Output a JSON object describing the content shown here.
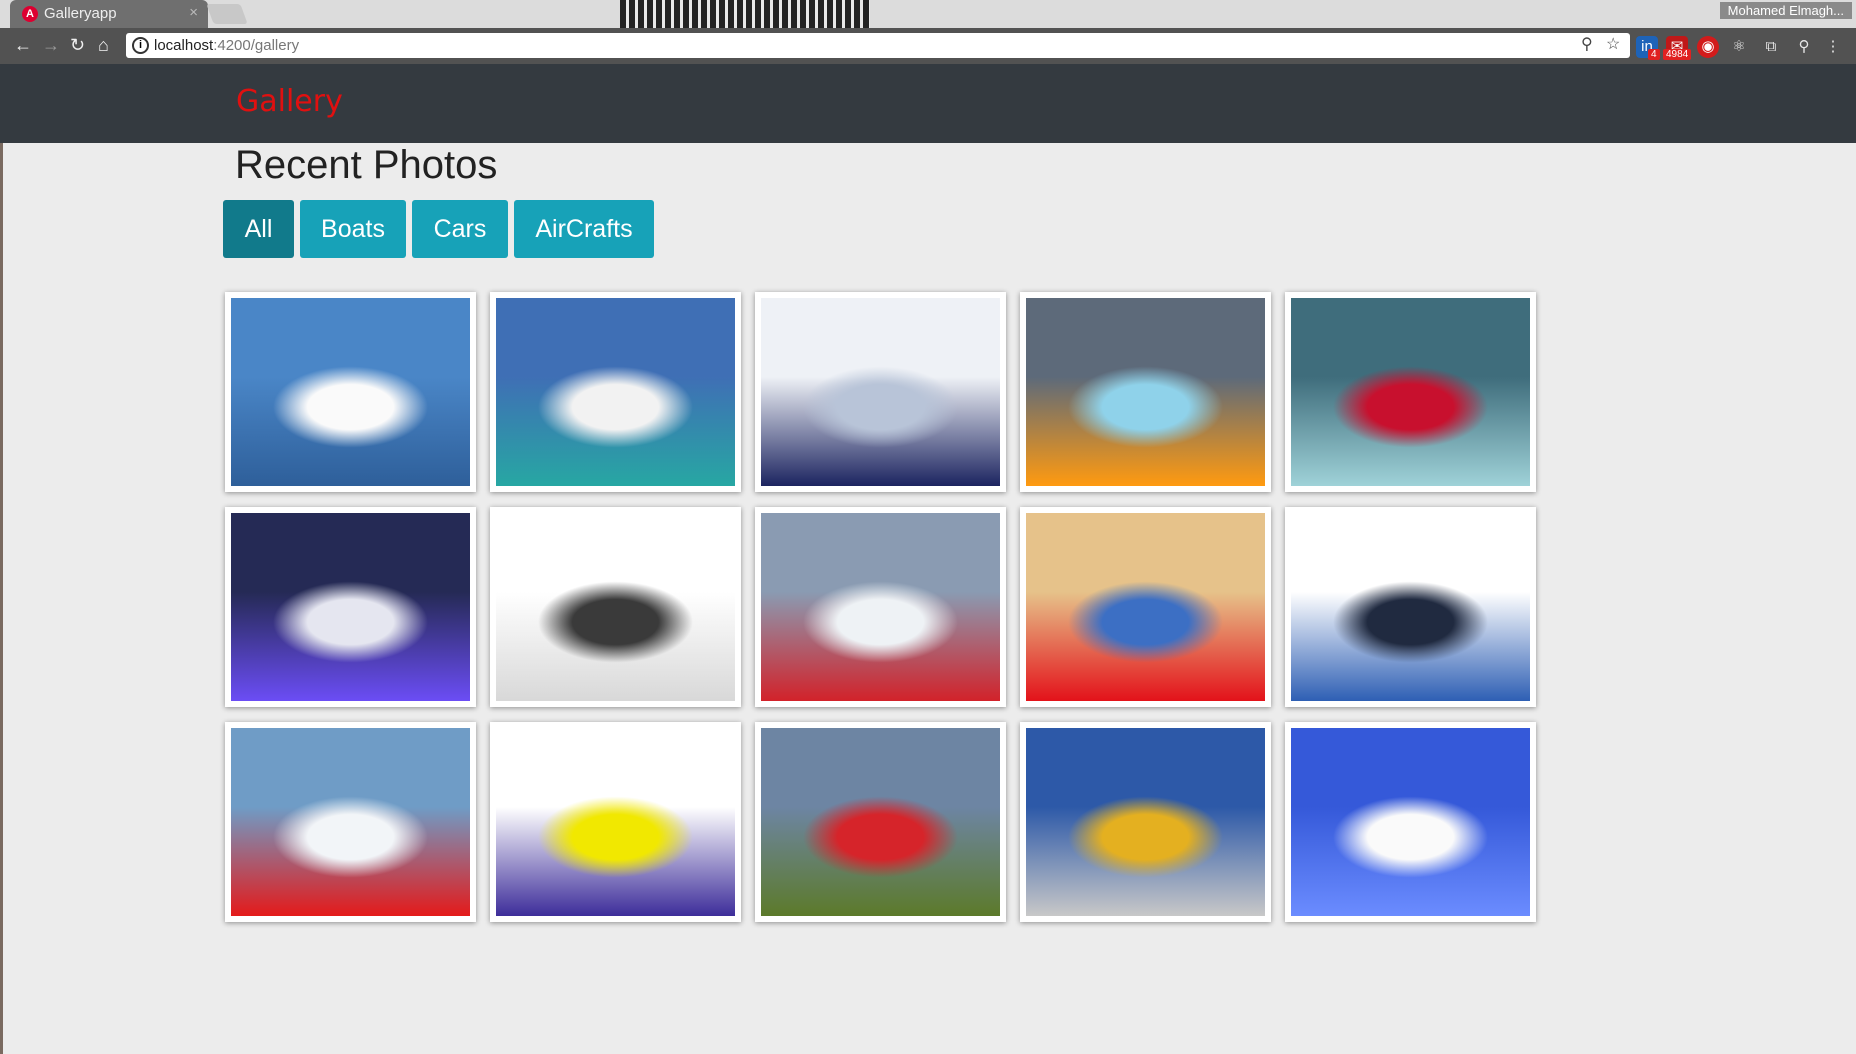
{
  "browser": {
    "tab_title": "Galleryapp",
    "tab_close": "×",
    "url_host": "localhost",
    "url_path": ":4200/gallery",
    "profile_name": "Mohamed Elmagh...",
    "ext_badge_1": "4",
    "ext_badge_2": "4984",
    "glyphs": {
      "back": "←",
      "forward": "→",
      "reload": "↻",
      "home": "⌂",
      "zoom": "⚲",
      "star": "☆",
      "menu": "⋮"
    }
  },
  "navbar": {
    "brand": "Gallery"
  },
  "main": {
    "heading": "Recent Photos",
    "filters": [
      {
        "label": "All",
        "active": true
      },
      {
        "label": "Boats",
        "active": false
      },
      {
        "label": "Cars",
        "active": false
      },
      {
        "label": "AirCrafts",
        "active": false
      }
    ],
    "photos": [
      {
        "category": "boat",
        "subject": "white yacht on blue sea",
        "palette": [
          "#4a86c7",
          "#2e5f9a",
          "#fafafa"
        ]
      },
      {
        "category": "boat",
        "subject": "large motor yacht on turquoise water",
        "palette": [
          "#3f6fb5",
          "#27a7a3",
          "#f2f2f2"
        ]
      },
      {
        "category": "boat",
        "subject": "speed bass boat",
        "palette": [
          "#eef1f6",
          "#1c2460",
          "#b8c4d8"
        ]
      },
      {
        "category": "boat",
        "subject": "orange pedal boat",
        "palette": [
          "#5d6a7a",
          "#ff9a10",
          "#8fd2ea"
        ]
      },
      {
        "category": "boat",
        "subject": "futuristic glass boat",
        "palette": [
          "#3f6d7c",
          "#9fd2d8",
          "#c8102e"
        ]
      },
      {
        "category": "car",
        "subject": "purple sports car",
        "palette": [
          "#252a55",
          "#6b4df5",
          "#e5e6f0"
        ]
      },
      {
        "category": "car",
        "subject": "white sports coupe",
        "palette": [
          "#ffffff",
          "#d8d8d8",
          "#3a3a3a"
        ]
      },
      {
        "category": "car",
        "subject": "red race car in snow",
        "palette": [
          "#8a9bb2",
          "#d2222a",
          "#eef2f5"
        ]
      },
      {
        "category": "car",
        "subject": "red cartoon race car",
        "palette": [
          "#e6c28a",
          "#e3121a",
          "#3c6fc4"
        ]
      },
      {
        "category": "car",
        "subject": "blue convertible",
        "palette": [
          "#ffffff",
          "#2e5fb4",
          "#202a40"
        ]
      },
      {
        "category": "aircraft",
        "subject": "red biplane above clouds",
        "palette": [
          "#6f9cc6",
          "#e41a1a",
          "#f2f5f8"
        ]
      },
      {
        "category": "aircraft",
        "subject": "purple and yellow jet",
        "palette": [
          "#ffffff",
          "#3d2d9a",
          "#f1e800"
        ]
      },
      {
        "category": "aircraft",
        "subject": "white and red plane over field",
        "palette": [
          "#6d85a3",
          "#5c7a2a",
          "#d6242a"
        ]
      },
      {
        "category": "aircraft",
        "subject": "large cargo aircraft",
        "palette": [
          "#2d59a8",
          "#c8c8c8",
          "#e4b020"
        ]
      },
      {
        "category": "aircraft",
        "subject": "paper airplane",
        "palette": [
          "#3559d9",
          "#6b8cff",
          "#fafafa"
        ]
      }
    ]
  }
}
